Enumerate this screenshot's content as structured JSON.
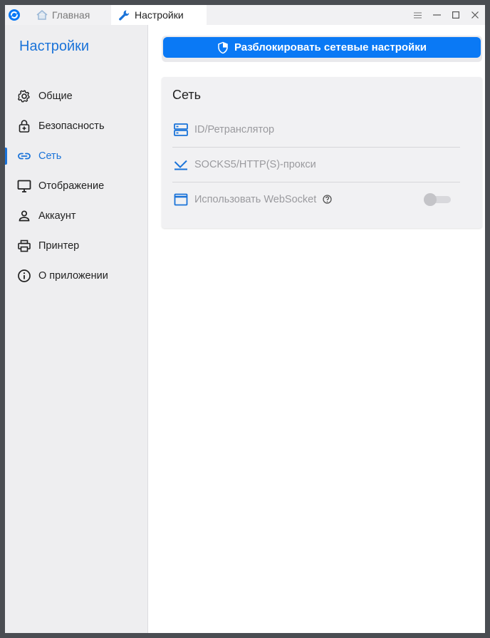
{
  "titlebar": {
    "tabs": [
      {
        "label": "Главная",
        "icon": "home-icon"
      },
      {
        "label": "Настройки",
        "icon": "wrench-icon"
      }
    ],
    "controls": [
      "menu-icon",
      "minimize-icon",
      "maximize-icon",
      "close-icon"
    ]
  },
  "sidebar": {
    "title": "Настройки",
    "items": [
      {
        "label": "Общие",
        "icon": "gear-icon"
      },
      {
        "label": "Безопасность",
        "icon": "lock-icon"
      },
      {
        "label": "Сеть",
        "icon": "link-icon",
        "active": true
      },
      {
        "label": "Отображение",
        "icon": "monitor-icon"
      },
      {
        "label": "Аккаунт",
        "icon": "person-icon"
      },
      {
        "label": "Принтер",
        "icon": "printer-icon"
      },
      {
        "label": "О приложении",
        "icon": "info-icon"
      }
    ]
  },
  "main": {
    "unlock_button": "Разблокировать сетевые настройки",
    "network": {
      "title": "Сеть",
      "rows": [
        {
          "label": "ID/Ретранслятор",
          "icon": "server-icon"
        },
        {
          "label": "SOCKS5/HTTP(S)-прокси",
          "icon": "proxy-icon"
        },
        {
          "label": "Использовать WebSocket",
          "icon": "window-icon",
          "toggle": false
        }
      ]
    }
  },
  "colors": {
    "accent": "#1a73d9",
    "button": "#0a79f5",
    "sidebar_bg": "#eeeef0",
    "card_bg": "#f1f1f3"
  }
}
